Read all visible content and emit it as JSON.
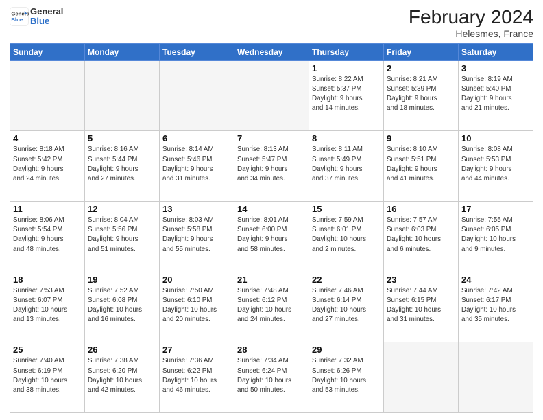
{
  "header": {
    "title": "February 2024",
    "subtitle": "Helesmes, France",
    "logo_line1": "General",
    "logo_line2": "Blue"
  },
  "weekdays": [
    "Sunday",
    "Monday",
    "Tuesday",
    "Wednesday",
    "Thursday",
    "Friday",
    "Saturday"
  ],
  "weeks": [
    [
      {
        "day": "",
        "info": ""
      },
      {
        "day": "",
        "info": ""
      },
      {
        "day": "",
        "info": ""
      },
      {
        "day": "",
        "info": ""
      },
      {
        "day": "1",
        "info": "Sunrise: 8:22 AM\nSunset: 5:37 PM\nDaylight: 9 hours\nand 14 minutes."
      },
      {
        "day": "2",
        "info": "Sunrise: 8:21 AM\nSunset: 5:39 PM\nDaylight: 9 hours\nand 18 minutes."
      },
      {
        "day": "3",
        "info": "Sunrise: 8:19 AM\nSunset: 5:40 PM\nDaylight: 9 hours\nand 21 minutes."
      }
    ],
    [
      {
        "day": "4",
        "info": "Sunrise: 8:18 AM\nSunset: 5:42 PM\nDaylight: 9 hours\nand 24 minutes."
      },
      {
        "day": "5",
        "info": "Sunrise: 8:16 AM\nSunset: 5:44 PM\nDaylight: 9 hours\nand 27 minutes."
      },
      {
        "day": "6",
        "info": "Sunrise: 8:14 AM\nSunset: 5:46 PM\nDaylight: 9 hours\nand 31 minutes."
      },
      {
        "day": "7",
        "info": "Sunrise: 8:13 AM\nSunset: 5:47 PM\nDaylight: 9 hours\nand 34 minutes."
      },
      {
        "day": "8",
        "info": "Sunrise: 8:11 AM\nSunset: 5:49 PM\nDaylight: 9 hours\nand 37 minutes."
      },
      {
        "day": "9",
        "info": "Sunrise: 8:10 AM\nSunset: 5:51 PM\nDaylight: 9 hours\nand 41 minutes."
      },
      {
        "day": "10",
        "info": "Sunrise: 8:08 AM\nSunset: 5:53 PM\nDaylight: 9 hours\nand 44 minutes."
      }
    ],
    [
      {
        "day": "11",
        "info": "Sunrise: 8:06 AM\nSunset: 5:54 PM\nDaylight: 9 hours\nand 48 minutes."
      },
      {
        "day": "12",
        "info": "Sunrise: 8:04 AM\nSunset: 5:56 PM\nDaylight: 9 hours\nand 51 minutes."
      },
      {
        "day": "13",
        "info": "Sunrise: 8:03 AM\nSunset: 5:58 PM\nDaylight: 9 hours\nand 55 minutes."
      },
      {
        "day": "14",
        "info": "Sunrise: 8:01 AM\nSunset: 6:00 PM\nDaylight: 9 hours\nand 58 minutes."
      },
      {
        "day": "15",
        "info": "Sunrise: 7:59 AM\nSunset: 6:01 PM\nDaylight: 10 hours\nand 2 minutes."
      },
      {
        "day": "16",
        "info": "Sunrise: 7:57 AM\nSunset: 6:03 PM\nDaylight: 10 hours\nand 6 minutes."
      },
      {
        "day": "17",
        "info": "Sunrise: 7:55 AM\nSunset: 6:05 PM\nDaylight: 10 hours\nand 9 minutes."
      }
    ],
    [
      {
        "day": "18",
        "info": "Sunrise: 7:53 AM\nSunset: 6:07 PM\nDaylight: 10 hours\nand 13 minutes."
      },
      {
        "day": "19",
        "info": "Sunrise: 7:52 AM\nSunset: 6:08 PM\nDaylight: 10 hours\nand 16 minutes."
      },
      {
        "day": "20",
        "info": "Sunrise: 7:50 AM\nSunset: 6:10 PM\nDaylight: 10 hours\nand 20 minutes."
      },
      {
        "day": "21",
        "info": "Sunrise: 7:48 AM\nSunset: 6:12 PM\nDaylight: 10 hours\nand 24 minutes."
      },
      {
        "day": "22",
        "info": "Sunrise: 7:46 AM\nSunset: 6:14 PM\nDaylight: 10 hours\nand 27 minutes."
      },
      {
        "day": "23",
        "info": "Sunrise: 7:44 AM\nSunset: 6:15 PM\nDaylight: 10 hours\nand 31 minutes."
      },
      {
        "day": "24",
        "info": "Sunrise: 7:42 AM\nSunset: 6:17 PM\nDaylight: 10 hours\nand 35 minutes."
      }
    ],
    [
      {
        "day": "25",
        "info": "Sunrise: 7:40 AM\nSunset: 6:19 PM\nDaylight: 10 hours\nand 38 minutes."
      },
      {
        "day": "26",
        "info": "Sunrise: 7:38 AM\nSunset: 6:20 PM\nDaylight: 10 hours\nand 42 minutes."
      },
      {
        "day": "27",
        "info": "Sunrise: 7:36 AM\nSunset: 6:22 PM\nDaylight: 10 hours\nand 46 minutes."
      },
      {
        "day": "28",
        "info": "Sunrise: 7:34 AM\nSunset: 6:24 PM\nDaylight: 10 hours\nand 50 minutes."
      },
      {
        "day": "29",
        "info": "Sunrise: 7:32 AM\nSunset: 6:26 PM\nDaylight: 10 hours\nand 53 minutes."
      },
      {
        "day": "",
        "info": ""
      },
      {
        "day": "",
        "info": ""
      }
    ]
  ]
}
